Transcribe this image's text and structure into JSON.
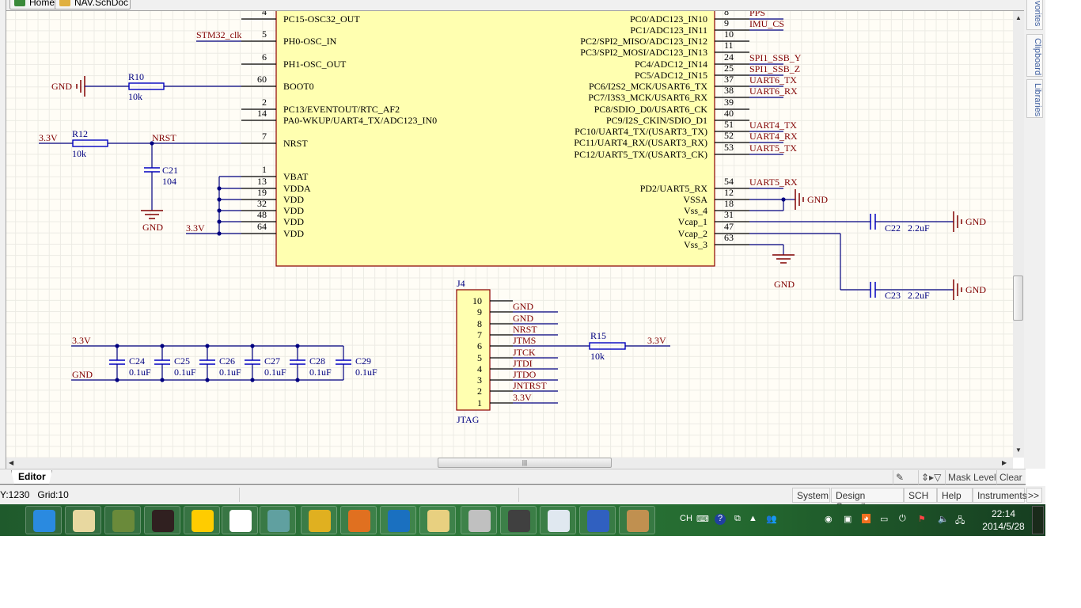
{
  "doc_tabs": [
    {
      "label": "Home",
      "icon": "home-icon"
    },
    {
      "label": "NAV.SchDoc",
      "icon": "schdoc-icon"
    }
  ],
  "colors": {
    "wire": "#000080",
    "net_label": "#800000",
    "component_body": "#ffffb0",
    "component_border": "#8b0000",
    "pin": "#000000",
    "designator": "#000080",
    "canvas": "#fffdf6",
    "taskbar": "#2f7a3c"
  },
  "chip": {
    "left_pins": [
      {
        "num": "4",
        "name": "PC15-OSC32_OUT"
      },
      {
        "num": "5",
        "name": "PH0-OSC_IN",
        "net": "STM32_clk"
      },
      {
        "num": "6",
        "name": "PH1-OSC_OUT"
      },
      {
        "num": "60",
        "name": "BOOT0"
      },
      {
        "num": "2",
        "name": "PC13/EVENTOUT/RTC_AF2"
      },
      {
        "num": "14",
        "name": "PA0-WKUP/UART4_TX/ADC123_IN0"
      },
      {
        "num": "7",
        "name": "NRST"
      },
      {
        "num": "1",
        "name": "VBAT"
      },
      {
        "num": "13",
        "name": "VDDA"
      },
      {
        "num": "19",
        "name": "VDD"
      },
      {
        "num": "32",
        "name": "VDD"
      },
      {
        "num": "48",
        "name": "VDD"
      },
      {
        "num": "64",
        "name": "VDD"
      }
    ],
    "right_pins": [
      {
        "num": "8",
        "name": "PC0/ADC123_IN10",
        "net": "PPS"
      },
      {
        "num": "9",
        "name": "PC1/ADC123_IN11",
        "net": "IMU_CS"
      },
      {
        "num": "10",
        "name": "PC2/SPI2_MISO/ADC123_IN12"
      },
      {
        "num": "11",
        "name": "PC3/SPI2_MOSI/ADC123_IN13"
      },
      {
        "num": "24",
        "name": "PC4/ADC12_IN14",
        "net": "SPI1_SSB_Y"
      },
      {
        "num": "25",
        "name": "PC5/ADC12_IN15",
        "net": "SPI1_SSB_Z"
      },
      {
        "num": "37",
        "name": "PC6/I2S2_MCK/USART6_TX",
        "net": "UART6_TX"
      },
      {
        "num": "38",
        "name": "PC7/I3S3_MCK/USART6_RX",
        "net": "UART6_RX"
      },
      {
        "num": "39",
        "name": "PC8/SDIO_D0/USART6_CK"
      },
      {
        "num": "40",
        "name": "PC9/I2S_CKIN/SDIO_D1"
      },
      {
        "num": "51",
        "name": "PC10/UART4_TX/(USART3_TX)",
        "net": "UART4_TX"
      },
      {
        "num": "52",
        "name": "PC11/UART4_RX/(USART3_RX)",
        "net": "UART4_RX"
      },
      {
        "num": "53",
        "name": "PC12/UART5_TX/(USART3_CK)",
        "net": "UART5_TX"
      },
      {
        "num": "54",
        "name": "PD2/UART5_RX",
        "net": "UART5_RX"
      },
      {
        "num": "12",
        "name": "VSSA"
      },
      {
        "num": "18",
        "name": "Vss_4"
      },
      {
        "num": "31",
        "name": "Vcap_1"
      },
      {
        "num": "47",
        "name": "Vcap_2"
      },
      {
        "num": "63",
        "name": "Vss_3"
      }
    ]
  },
  "parts": {
    "r10": {
      "ref": "R10",
      "value": "10k"
    },
    "r12": {
      "ref": "R12",
      "value": "10k"
    },
    "r15": {
      "ref": "R15",
      "value": "10k"
    },
    "c21": {
      "ref": "C21",
      "value": "104"
    },
    "c22": {
      "ref": "C22",
      "value": "2.2uF"
    },
    "c23": {
      "ref": "C23",
      "value": "2.2uF"
    },
    "decoupling": [
      {
        "ref": "C24",
        "value": "0.1uF"
      },
      {
        "ref": "C25",
        "value": "0.1uF"
      },
      {
        "ref": "C26",
        "value": "0.1uF"
      },
      {
        "ref": "C27",
        "value": "0.1uF"
      },
      {
        "ref": "C28",
        "value": "0.1uF"
      },
      {
        "ref": "C29",
        "value": "0.1uF"
      }
    ]
  },
  "nets": {
    "gnd": "GND",
    "v33": "3.3V",
    "nrst": "NRST"
  },
  "j4": {
    "ref": "J4",
    "value": "JTAG",
    "pins": [
      {
        "num": "10"
      },
      {
        "num": "9",
        "net": "GND"
      },
      {
        "num": "8",
        "net": "GND"
      },
      {
        "num": "7",
        "net": "NRST"
      },
      {
        "num": "6",
        "net": "JTMS"
      },
      {
        "num": "5",
        "net": "JTCK"
      },
      {
        "num": "4",
        "net": "JTDI"
      },
      {
        "num": "3",
        "net": "JTDO"
      },
      {
        "num": "2",
        "net": "JNTRST"
      },
      {
        "num": "1",
        "net": "3.3V"
      }
    ]
  },
  "editor": {
    "tab": "Editor",
    "mask_level": "Mask Level",
    "clear": "Clear"
  },
  "right_panels": [
    "vorites",
    "Clipboard",
    "Libraries"
  ],
  "status": {
    "coords": "Y:1230",
    "grid": "Grid:10",
    "buttons": [
      "System",
      "Design Compiler",
      "SCH",
      "Help",
      "Instruments",
      ">>"
    ]
  },
  "taskbar": {
    "apps": [
      "browser",
      "calligraphy-app",
      "penguin-app",
      "brand-app",
      "qq",
      "big-app",
      "planet-app",
      "gold-coin-app",
      "castle-app",
      "k-app",
      "folder",
      "drive",
      "book-app",
      "text-editor",
      "word",
      "paint"
    ],
    "lang": "CH",
    "time": "22:14",
    "date": "2014/5/28"
  }
}
